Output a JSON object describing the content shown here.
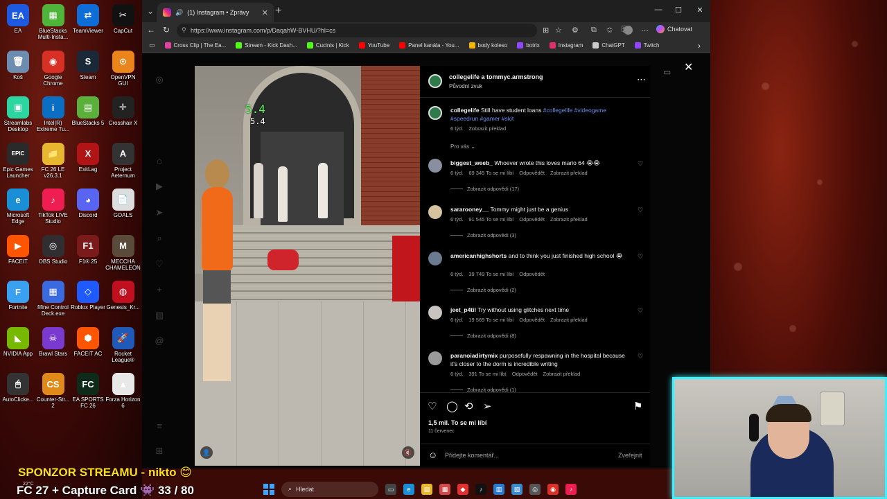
{
  "desktop": {
    "icons": [
      {
        "label": "EA",
        "glyph": "EA",
        "color": "#1d5ae0"
      },
      {
        "label": "BlueStacks Multi-Insta...",
        "glyph": "▦",
        "color": "#4fb43a"
      },
      {
        "label": "TeamViewer",
        "glyph": "⇄",
        "color": "#0e6dd6"
      },
      {
        "label": "CapCut",
        "glyph": "✂",
        "color": "#111111"
      },
      {
        "label": "Koš",
        "glyph": "🗑",
        "color": "#6d8db0"
      },
      {
        "label": "Google Chrome",
        "glyph": "◉",
        "color": "#d93025"
      },
      {
        "label": "Steam",
        "glyph": "S",
        "color": "#1b2838"
      },
      {
        "label": "OpenVPN GUI",
        "glyph": "⊙",
        "color": "#e9851a"
      },
      {
        "label": "Streamlabs Desktop",
        "glyph": "▣",
        "color": "#2bd6a0"
      },
      {
        "label": "Intel(R) Extreme Tu...",
        "glyph": "i",
        "color": "#0a6fc2"
      },
      {
        "label": "BlueStacks 5",
        "glyph": "▤",
        "color": "#5ab03a"
      },
      {
        "label": "Crosshair X",
        "glyph": "✛",
        "color": "#222222"
      },
      {
        "label": "Epic Games Launcher",
        "glyph": "EPIC",
        "color": "#2a2a2a"
      },
      {
        "label": "FC 26 LE v26.3.1",
        "glyph": "📁",
        "color": "#e8b730"
      },
      {
        "label": "ExitLag",
        "glyph": "X",
        "color": "#b01414"
      },
      {
        "label": "Project Aeternum",
        "glyph": "A",
        "color": "#333333"
      },
      {
        "label": "Microsoft Edge",
        "glyph": "e",
        "color": "#1a8fd6"
      },
      {
        "label": "TikTok LIVE Studio",
        "glyph": "♪",
        "color": "#ee1d52"
      },
      {
        "label": "Discord",
        "glyph": "◕",
        "color": "#5865f2"
      },
      {
        "label": "GOALS",
        "glyph": "📄",
        "color": "#dddddd"
      },
      {
        "label": "FACEIT",
        "glyph": "▶",
        "color": "#ff5500"
      },
      {
        "label": "OBS Studio",
        "glyph": "◎",
        "color": "#302e31"
      },
      {
        "label": "F1® 25",
        "glyph": "F1",
        "color": "#7a1a1a"
      },
      {
        "label": "MECCHA CHAMELEON",
        "glyph": "M",
        "color": "#5a4a3a"
      },
      {
        "label": "Fortnite",
        "glyph": "F",
        "color": "#3aa0f0"
      },
      {
        "label": "fifine Control Deck.exe",
        "glyph": "▦",
        "color": "#3a6ae0"
      },
      {
        "label": "Roblox Player",
        "glyph": "◇",
        "color": "#1e5aff"
      },
      {
        "label": "Genesis_Kr...",
        "glyph": "◍",
        "color": "#c01020"
      },
      {
        "label": "NVIDIA App",
        "glyph": "◣",
        "color": "#76b900"
      },
      {
        "label": "Brawl Stars",
        "glyph": "☠",
        "color": "#7a3ad0"
      },
      {
        "label": "FACEIT AC",
        "glyph": "⬢",
        "color": "#ff5500"
      },
      {
        "label": "Rocket League®",
        "glyph": "🚀",
        "color": "#1f5ab8"
      },
      {
        "label": "AutoClicke...",
        "glyph": "🖱",
        "color": "#333333"
      },
      {
        "label": "Counter-Str... 2",
        "glyph": "CS",
        "color": "#e08a1a"
      },
      {
        "label": "EA SPORTS FC 26",
        "glyph": "FC",
        "color": "#0d2a1a"
      },
      {
        "label": "Forza Horizon 6",
        "glyph": "▲",
        "color": "#e8e8e8"
      }
    ]
  },
  "browser": {
    "tab_title": "(1) Instagram • Zprávy",
    "url": "https://www.instagram.com/p/DaqahW-BVHU/?hl=cs",
    "copilot_label": "Chatovat",
    "bookmarks": [
      {
        "label": "Cross Clip | The Ea...",
        "color": "#e040a0"
      },
      {
        "label": "Stream - Kick Dash...",
        "color": "#53fc18"
      },
      {
        "label": "Cucinis | Kick",
        "color": "#53fc18"
      },
      {
        "label": "YouTube",
        "color": "#ff0000"
      },
      {
        "label": "Panel kanála - You...",
        "color": "#ff0000"
      },
      {
        "label": "body koleso",
        "color": "#f4b400"
      },
      {
        "label": "botrix",
        "color": "#9146ff"
      },
      {
        "label": "Instagram",
        "color": "#e1306c"
      },
      {
        "label": "ChatGPT",
        "color": "#cccccc"
      },
      {
        "label": "Twitch",
        "color": "#9146ff"
      }
    ]
  },
  "video": {
    "timer_main": "5.4",
    "timer_sub": "5.4"
  },
  "post": {
    "header_user": "collegelife a tommyc.armstrong",
    "header_audio": "Původní zvuk",
    "caption": {
      "user": "collegelife",
      "text": "Still have student loans",
      "tags": "#collegelife #videogame #speedrun #gamer #skit",
      "age": "6 týd.",
      "translate": "Zobrazit překlad"
    },
    "for_you": "Pro vás",
    "comments": [
      {
        "user": "biggest_weeb_",
        "text": "Whoever wrote this loves mario 64",
        "emoji": "😭😭",
        "age": "6 týd.",
        "likes": "69 345 To se mi líbí",
        "reply": "Odpovědět",
        "translate": "Zobrazit překlad",
        "replies": "Zobrazit odpovědi (17)",
        "avatar": "#8a8fa0"
      },
      {
        "user": "sararooney__",
        "text": "Tommy might just be a genius",
        "emoji": "",
        "age": "6 týd.",
        "likes": "91 545 To se mi líbí",
        "reply": "Odpovědět",
        "translate": "Zobrazit překlad",
        "replies": "Zobrazit odpovědi (3)",
        "avatar": "#d4c2a0"
      },
      {
        "user": "americanhighshorts",
        "text": "and to think you just finished high school",
        "emoji": "😭",
        "age": "6 týd.",
        "likes": "39 749 To se mi líbí",
        "reply": "Odpovědět",
        "translate": "",
        "replies": "Zobrazit odpovědi (2)",
        "avatar": "#6a7a90"
      },
      {
        "user": "jeet_p4til",
        "text": "Try without using glitches next time",
        "emoji": "",
        "age": "6 týd.",
        "likes": "19 569 To se mi líbí",
        "reply": "Odpovědět",
        "translate": "Zobrazit překlad",
        "replies": "Zobrazit odpovědi (8)",
        "avatar": "#c9c4c0"
      },
      {
        "user": "paranoiadirtymix",
        "text": "purposefully respawning in the hospital because it's closer to the dorm is incredible writing",
        "emoji": "",
        "age": "6 týd.",
        "likes": "391 To se mi líbí",
        "reply": "Odpovědět",
        "translate": "Zobrazit překlad",
        "replies": "Zobrazit odpovědi (1)",
        "avatar": "#9a9a9a"
      }
    ],
    "likes_total": "1,5 mil. To se mi líbí",
    "date": "11 červenec",
    "comment_placeholder": "Přidejte komentář...",
    "post_label": "Zveřejnit"
  },
  "overlay": {
    "sponsor": "SPONZOR STREAMU - nikto 😊",
    "goal": "FC 27 + Capture Card 👾 33 / 80",
    "temperature": "22°C"
  },
  "taskbar": {
    "search_placeholder": "Hledat"
  },
  "colors": {
    "accent_link": "#6a8fe8",
    "webcam_border": "#3cf0ff",
    "sponsor_text": "#ffde1a"
  }
}
